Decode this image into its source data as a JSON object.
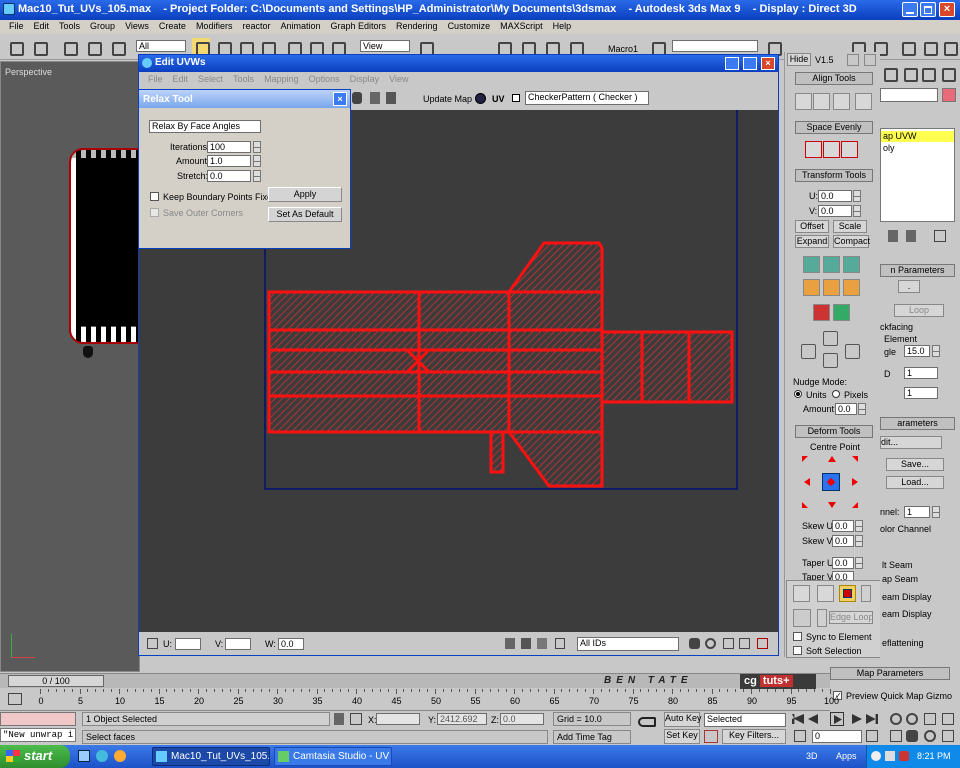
{
  "title_bar": {
    "title": "Mac10_Tut_UVs_105.max    - Project Folder: C:\\Documents and Settings\\HP_Administrator\\My Documents\\3dsmax    - Autodesk 3ds Max 9    - Display : Direct 3D"
  },
  "menu": [
    "File",
    "Edit",
    "Tools",
    "Group",
    "Views",
    "Create",
    "Modifiers",
    "reactor",
    "Animation",
    "Graph Editors",
    "Rendering",
    "Customize",
    "MAXScript",
    "Help"
  ],
  "main_toolbar": {
    "selection_filter": "All",
    "view_dropdown": "View",
    "named_selection": "Macro1"
  },
  "viewport": {
    "label": "Perspective"
  },
  "edit_uvws": {
    "title": "Edit UVWs",
    "menu": [
      "File",
      "Edit",
      "Select",
      "Tools",
      "Mapping",
      "Options",
      "Display",
      "View"
    ],
    "update_map": "Update Map",
    "uv_label": "UV",
    "texture_dropdown": "CheckerPattern  ( Checker )",
    "bottom": {
      "u_label": "U:",
      "u_value": "",
      "v_label": "V:",
      "v_value": "",
      "w_label": "W:",
      "w_value": "0.0",
      "ids_dropdown": "All IDs"
    }
  },
  "relax_tool": {
    "title": "Relax Tool",
    "method": "Relax By Face Angles",
    "iterations_label": "Iterations:",
    "iterations": "100",
    "amount_label": "Amount:",
    "amount": "1.0",
    "stretch_label": "Stretch:",
    "stretch": "0.0",
    "keep_boundary": "Keep Boundary Points Fixed",
    "save_outer": "Save Outer Corners",
    "apply": "Apply",
    "set_default": "Set As Default"
  },
  "uv_toolbox": {
    "hide": "Hide",
    "version": "V1.5",
    "align_tools": "Align Tools",
    "space_evenly": "Space Evenly",
    "transform_tools": "Transform Tools",
    "u_label": "U:",
    "u_value": "0.0",
    "v_label": "V:",
    "v_value": "0.0",
    "offset": "Offset",
    "scale": "Scale",
    "expand": "Expand",
    "compact": "Compact",
    "nudge_mode": "Nudge Mode:",
    "units": "Units",
    "pixels": "Pixels",
    "amount_label": "Amount:",
    "amount_value": "0.0",
    "deform_tools": "Deform Tools",
    "centre_point": "Centre Point",
    "skew_u": "Skew U",
    "skew_u_value": "0.0",
    "skew_v": "Skew V",
    "skew_v_value": "0.0",
    "taper_u": "Taper U",
    "taper_u_value": "0.0",
    "taper_v": "Taper V",
    "taper_v_value": "0.0",
    "edge_loop": "Edge Loop",
    "sync_to_element": "Sync to Element",
    "soft_selection": "Soft Selection"
  },
  "command_panel": {
    "stack_item_1": "ap UVW",
    "stack_item_2": "oly",
    "params_header": "n Parameters",
    "loop": "Loop",
    "backfacing": "ckfacing",
    "element": "Element",
    "angle_label": "gle",
    "angle_value": "15.0",
    "d_label": "D",
    "d_value": "1",
    "value_1": "1",
    "params_header2": "arameters",
    "edit": "dit...",
    "save": "Save...",
    "load": "Load...",
    "channel_label": "nnel:",
    "channel_value": "1",
    "color_channel": "olor Channel",
    "lt_seam": "lt Seam",
    "ap_seam": "ap Seam",
    "seam_display": "eam Display",
    "seam_display2": "eam Display",
    "reflattening": "eflattening",
    "map_parameters": "Map Parameters",
    "preview_gizmo": "Preview Quick Map Gizmo"
  },
  "timeline": {
    "frame": "0 / 100",
    "ticks": [
      "0",
      "5",
      "10",
      "15",
      "20",
      "25",
      "30",
      "35",
      "40",
      "45",
      "50",
      "55",
      "60",
      "65",
      "70",
      "75",
      "80",
      "85",
      "90",
      "95",
      "100"
    ],
    "watermark": "BEN TATE",
    "logo_a": "cg",
    "logo_b": "tuts+"
  },
  "status": {
    "listener": "\"New unwrap i",
    "objects_selected": "1 Object Selected",
    "prompt": "Select faces",
    "x_label": "X:",
    "x_value": "",
    "y_label": "Y:",
    "y_value": "2412.692",
    "z_label": "Z:",
    "z_value": "0.0",
    "grid": "Grid = 10.0",
    "add_time_tag": "Add Time Tag",
    "auto_key": "Auto Key",
    "set_key": "Set Key",
    "selected_dropdown": "Selected",
    "key_filters": "Key Filters...",
    "frame_value": "0"
  },
  "taskbar": {
    "start": "start",
    "items": [
      "Mac10_Tut_UVs_105...",
      "Camtasia Studio - UV ..."
    ],
    "tray_3d": "3D",
    "tray_apps": "Apps",
    "clock": "8:21 PM"
  },
  "colors": {
    "uv_wire": "#ff1010",
    "viewport_bg": "#3c3c3c",
    "titlebar": "#0a4fd4",
    "xp_taskbar": "#245edb",
    "start_green": "#2e9e2e"
  }
}
